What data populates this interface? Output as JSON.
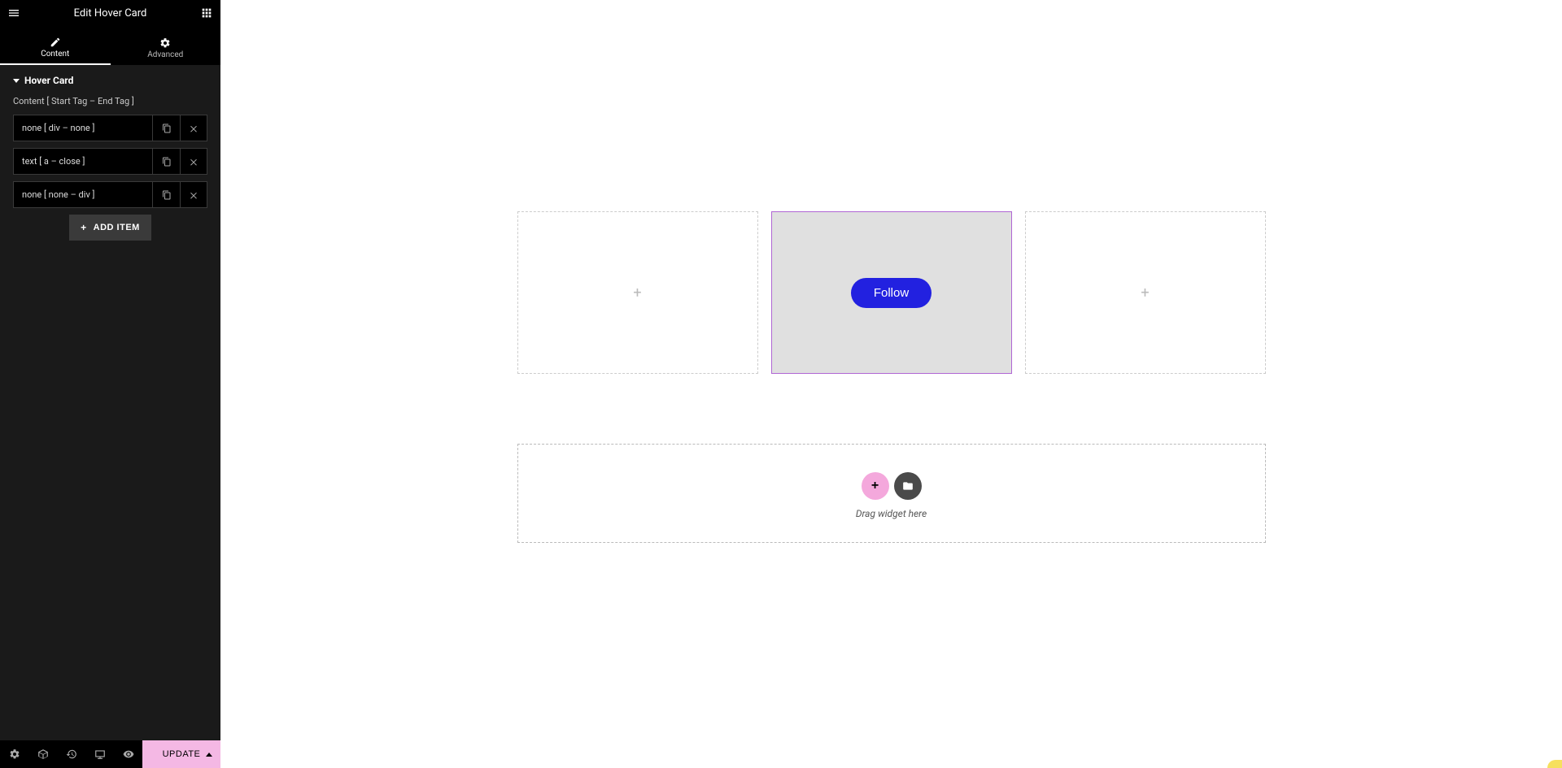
{
  "sidebar": {
    "header_title": "Edit Hover Card",
    "tabs": {
      "content_label": "Content",
      "advanced_label": "Advanced"
    },
    "section": {
      "name": "Hover Card",
      "subtitle": "Content [ Start Tag – End Tag ]"
    },
    "items": [
      {
        "label": "none [ div – none ]"
      },
      {
        "label": "text [ a – close ]"
      },
      {
        "label": "none [ none – div ]"
      }
    ],
    "add_item_label": "ADD ITEM"
  },
  "footer": {
    "update_label": "UPDATE"
  },
  "canvas": {
    "follow_label": "Follow",
    "drag_hint": "Drag widget here"
  }
}
